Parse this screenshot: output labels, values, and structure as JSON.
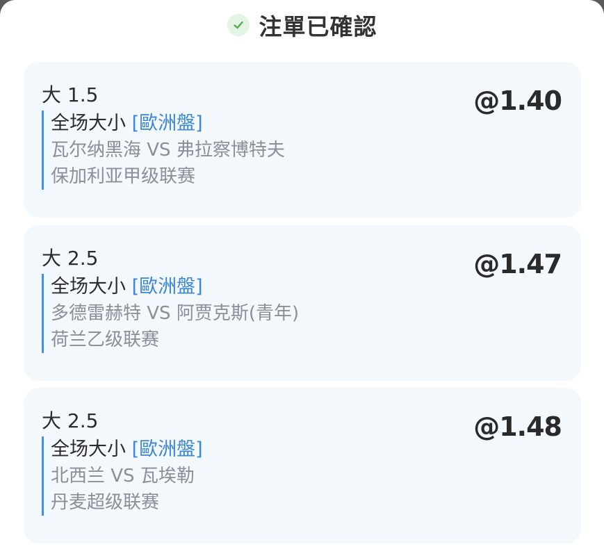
{
  "header": {
    "icon": "check-circle-icon",
    "title": "注單已確認",
    "accent_color": "#4caf50"
  },
  "bets": [
    {
      "pick": "大 1.5",
      "odds": "@1.40",
      "market": "全场大小",
      "market_type": "[歐洲盤]",
      "match": "瓦尔纳黑海 VS 弗拉察博特夫",
      "league": "保加利亚甲级联赛"
    },
    {
      "pick": "大 2.5",
      "odds": "@1.47",
      "market": "全场大小",
      "market_type": "[歐洲盤]",
      "match": "多德雷赫特 VS 阿贾克斯(青年)",
      "league": "荷兰乙级联赛"
    },
    {
      "pick": "大 2.5",
      "odds": "@1.48",
      "market": "全场大小",
      "market_type": "[歐洲盤]",
      "match": "北西兰 VS 瓦埃勒",
      "league": "丹麦超级联赛"
    }
  ]
}
